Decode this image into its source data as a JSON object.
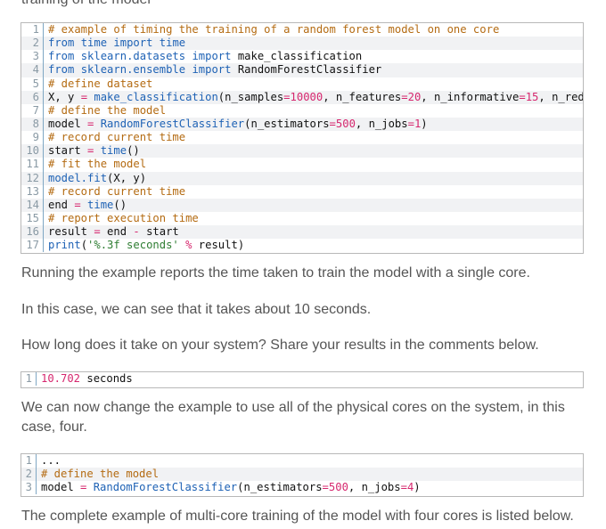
{
  "truncated_top_text": "training of the model",
  "code_block_1": {
    "lines": [
      {
        "no": "1",
        "text": "# example of timing the training of a random forest model on one core"
      },
      {
        "no": "2",
        "text": "from time import time"
      },
      {
        "no": "3",
        "text": "from sklearn.datasets import make_classification"
      },
      {
        "no": "4",
        "text": "from sklearn.ensemble import RandomForestClassifier"
      },
      {
        "no": "5",
        "text": "# define dataset"
      },
      {
        "no": "6",
        "text": "X, y = make_classification(n_samples=10000, n_features=20, n_informative=15, n_red"
      },
      {
        "no": "7",
        "text": "# define the model"
      },
      {
        "no": "8",
        "text": "model = RandomForestClassifier(n_estimators=500, n_jobs=1)"
      },
      {
        "no": "9",
        "text": "# record current time"
      },
      {
        "no": "10",
        "text": "start = time()"
      },
      {
        "no": "11",
        "text": "# fit the model"
      },
      {
        "no": "12",
        "text": "model.fit(X, y)"
      },
      {
        "no": "13",
        "text": "# record current time"
      },
      {
        "no": "14",
        "text": "end = time()"
      },
      {
        "no": "15",
        "text": "# report execution time"
      },
      {
        "no": "16",
        "text": "result = end - start"
      },
      {
        "no": "17",
        "text": "print('%.3f seconds' % result)"
      }
    ]
  },
  "para_1": "Running the example reports the time taken to train the model with a single core.",
  "para_2": "In this case, we can see that it takes about 10 seconds.",
  "para_3": "How long does it take on your system? Share your results in the comments below.",
  "code_block_2": {
    "lines": [
      {
        "no": "1",
        "text": "10.702 seconds"
      }
    ]
  },
  "para_4": "We can now change the example to use all of the physical cores on the system, in this case, four.",
  "code_block_3": {
    "lines": [
      {
        "no": "1",
        "text": "..."
      },
      {
        "no": "2",
        "text": "# define the model"
      },
      {
        "no": "3",
        "text": "model = RandomForestClassifier(n_estimators=500, n_jobs=4)"
      }
    ]
  },
  "para_5": "The complete example of multi-core training of the model with four cores is listed below."
}
